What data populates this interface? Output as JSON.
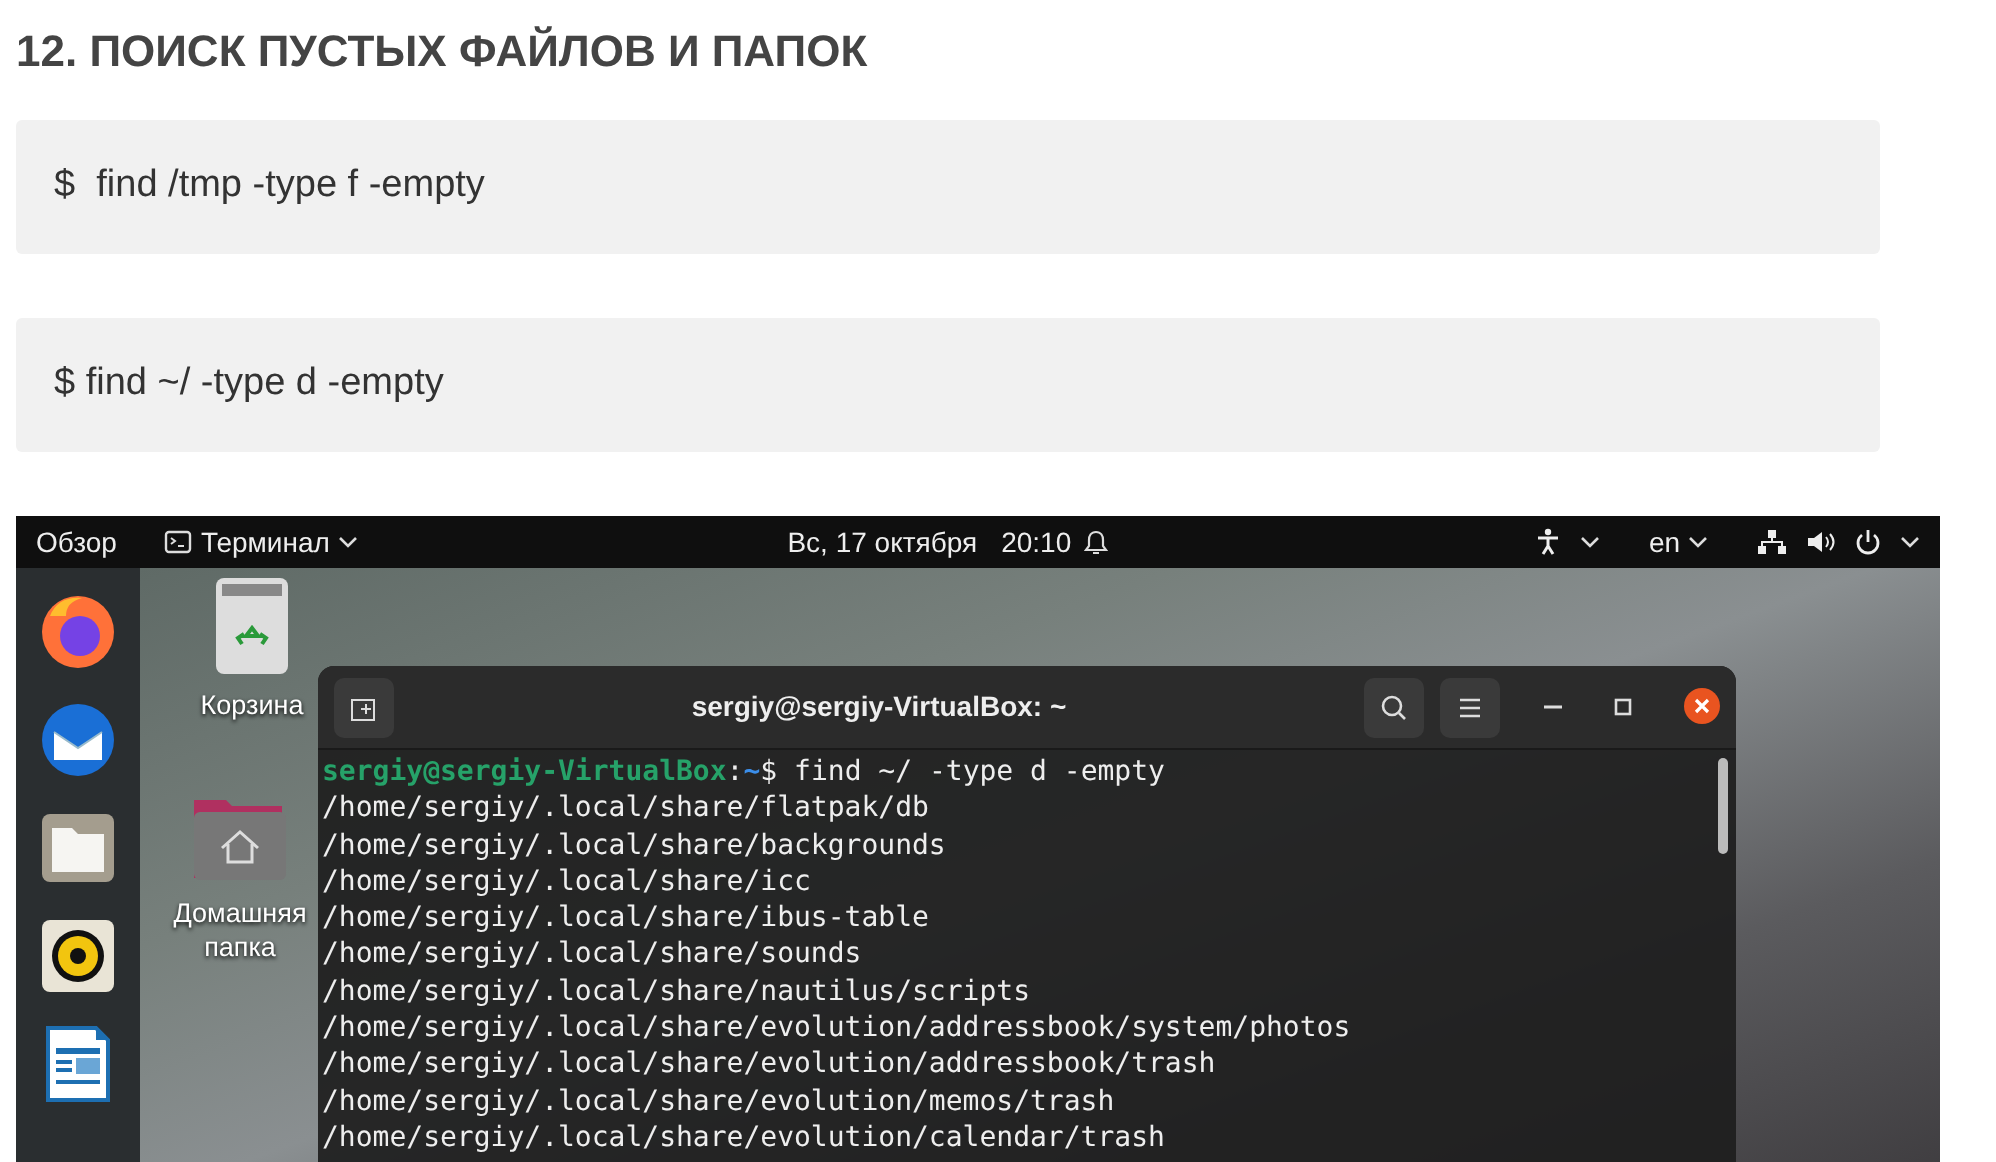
{
  "heading": "12. ПОИСК ПУСТЫХ ФАЙЛОВ И ПАПОК",
  "code_blocks": [
    "$  find /tmp -type f -empty",
    "$ find ~/ -type d -empty"
  ],
  "screenshot": {
    "top_bar": {
      "activities": "Обзор",
      "app_menu": "Терминал",
      "date": "Вс, 17 октября",
      "time": "20:10",
      "language": "en"
    },
    "desktop_icons": [
      {
        "kind": "trash",
        "label": "Корзина"
      },
      {
        "kind": "home",
        "label": "Домашняя папка"
      }
    ],
    "terminal": {
      "title": "sergiy@sergiy-VirtualBox: ~",
      "prompt": {
        "user": "sergiy@sergiy-VirtualBox",
        "separator": ":",
        "path": "~",
        "command": "$ find ~/ -type d -empty"
      },
      "output": [
        "/home/sergiy/.local/share/flatpak/db",
        "/home/sergiy/.local/share/backgrounds",
        "/home/sergiy/.local/share/icc",
        "/home/sergiy/.local/share/ibus-table",
        "/home/sergiy/.local/share/sounds",
        "/home/sergiy/.local/share/nautilus/scripts",
        "/home/sergiy/.local/share/evolution/addressbook/system/photos",
        "/home/sergiy/.local/share/evolution/addressbook/trash",
        "/home/sergiy/.local/share/evolution/memos/trash",
        "/home/sergiy/.local/share/evolution/calendar/trash"
      ]
    }
  }
}
